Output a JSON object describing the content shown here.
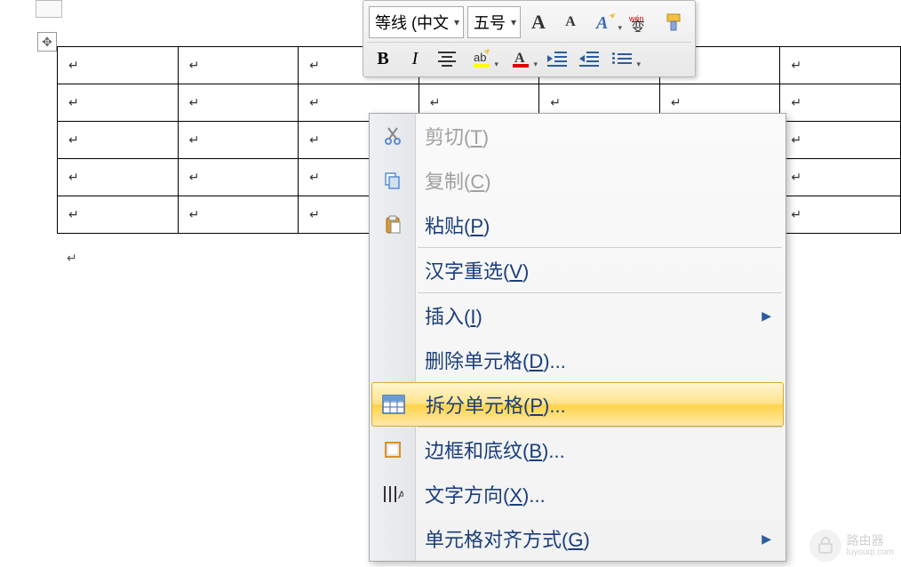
{
  "toolbar": {
    "font_name": "等线 (中文",
    "font_size": "五号",
    "grow_font_tip": "A",
    "shrink_font_tip": "A"
  },
  "table": {
    "rows": 5,
    "cols": 7,
    "cell_marker": "↵"
  },
  "paragraph_mark": "↵",
  "context_menu": {
    "cut": "剪切(T)",
    "copy": "复制(C)",
    "paste": "粘贴(P)",
    "reconvert": "汉字重选(V)",
    "insert": "插入(I)",
    "delete_cells": "删除单元格(D)...",
    "split_cells": "拆分单元格(P)...",
    "borders_shading": "边框和底纹(B)...",
    "text_direction": "文字方向(X)...",
    "cell_alignment": "单元格对齐方式(G)"
  },
  "watermark": {
    "title": "路由器",
    "url": "luyouqi.com"
  }
}
